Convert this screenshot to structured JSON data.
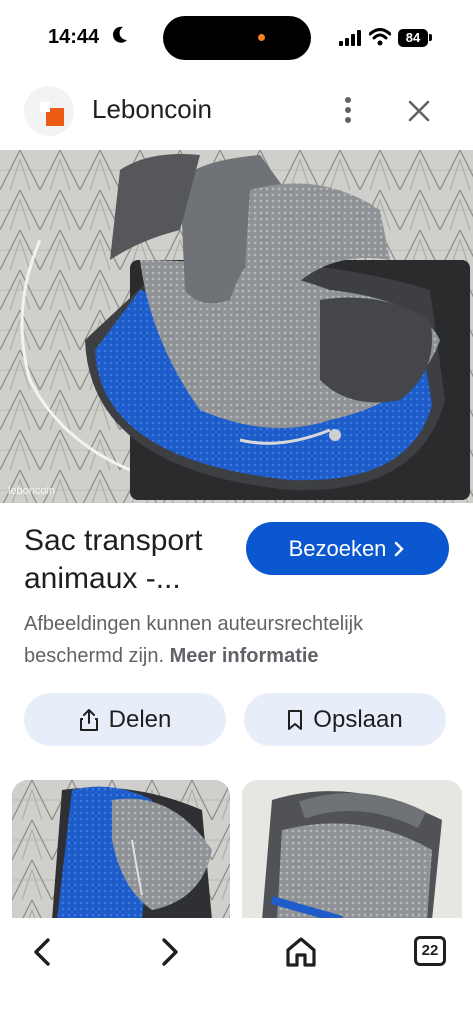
{
  "status_bar": {
    "time": "14:44",
    "battery": "84"
  },
  "header": {
    "site_name": "Leboncoin"
  },
  "image": {
    "watermark": "leboncoin"
  },
  "result": {
    "title": "Sac transport animaux -...",
    "visit_label": "Bezoeken",
    "copyright_text": "Afbeeldingen kunnen auteursrechtelijk beschermd zijn.",
    "more_info_link": "Meer informatie"
  },
  "actions": {
    "share_label": "Delen",
    "save_label": "Opslaan"
  },
  "bottom_nav": {
    "tabs_count": "22"
  },
  "colors": {
    "accent": "#0b57d0",
    "pill_bg": "#e8eef9",
    "logo": "#ec5a13",
    "bag_blue": "#1f5fcf",
    "bag_gray": "#8f9296"
  },
  "icons": [
    "moon-icon",
    "signal-icon",
    "wifi-icon",
    "battery-icon",
    "more-vert-icon",
    "close-icon",
    "chevron-right-icon",
    "share-icon",
    "bookmark-icon",
    "back-icon",
    "forward-icon",
    "home-icon",
    "tabs-icon"
  ]
}
